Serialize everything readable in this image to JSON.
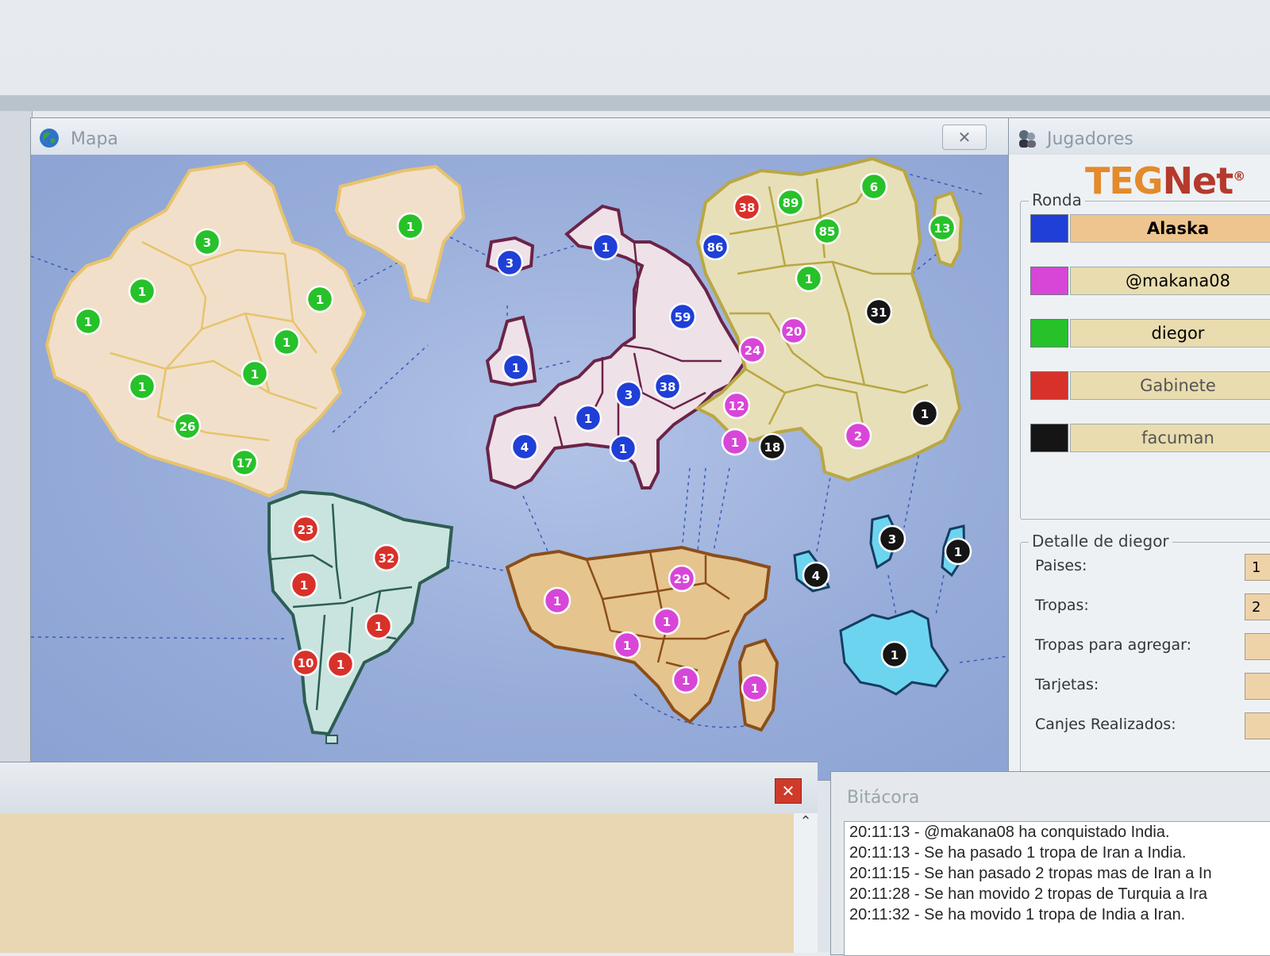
{
  "map_window": {
    "title": "Mapa",
    "close_label": "✕"
  },
  "players_window": {
    "title": "Jugadores",
    "brand_teg": "TEG",
    "brand_net": "Net",
    "brand_mark": "®"
  },
  "ronda": {
    "legend": "Ronda",
    "players": [
      {
        "name": "Alaska",
        "color": "#1f3fd6",
        "bg": "#efc58f"
      },
      {
        "name": "@makana08",
        "color": "#d846d8",
        "bg": "#e9dcae"
      },
      {
        "name": "diegor",
        "color": "#27c12a",
        "bg": "#e9dcae"
      },
      {
        "name": "Gabinete",
        "color": "#d8312a",
        "bg": "#e9dcae"
      },
      {
        "name": "facuman",
        "color": "#151515",
        "bg": "#e9dcae"
      }
    ]
  },
  "detalle": {
    "legend": "Detalle de diegor",
    "rows": [
      {
        "label": "Paises:",
        "value": "1"
      },
      {
        "label": "Tropas:",
        "value": "2"
      },
      {
        "label": "Tropas para agregar:",
        "value": ""
      },
      {
        "label": "Tarjetas:",
        "value": ""
      },
      {
        "label": "Canjes Realizados:",
        "value": ""
      }
    ]
  },
  "bottom_window": {
    "close_label": "✕",
    "scroll_up": "⌃"
  },
  "bitacora": {
    "title": "Bitácora",
    "lines": [
      "20:11:13 - @makana08 ha conquistado India.",
      "20:11:13 - Se ha pasado 1 tropa de Iran a India.",
      "20:11:15 - Se han pasado 2 tropas mas de Iran a In",
      "20:11:28 - Se han movido 2 tropas de Turquia a Ira",
      "20:11:32 - Se ha movido 1 tropa de India a Iran."
    ]
  },
  "colors": {
    "blue": "#1f3fd6",
    "pink": "#d846d8",
    "green": "#27c12a",
    "red": "#d8312a",
    "black": "#151515"
  },
  "troops": [
    {
      "v": "3",
      "c": "green"
    },
    {
      "v": "1",
      "c": "green"
    },
    {
      "v": "1",
      "c": "green"
    },
    {
      "v": "1",
      "c": "green"
    },
    {
      "v": "1",
      "c": "green"
    },
    {
      "v": "1",
      "c": "green"
    },
    {
      "v": "1",
      "c": "green"
    },
    {
      "v": "1",
      "c": "green"
    },
    {
      "v": "26",
      "c": "green"
    },
    {
      "v": "17",
      "c": "green"
    },
    {
      "v": "23",
      "c": "red"
    },
    {
      "v": "32",
      "c": "red"
    },
    {
      "v": "1",
      "c": "red"
    },
    {
      "v": "1",
      "c": "red"
    },
    {
      "v": "10",
      "c": "red"
    },
    {
      "v": "1",
      "c": "red"
    },
    {
      "v": "3",
      "c": "blue"
    },
    {
      "v": "1",
      "c": "blue"
    },
    {
      "v": "1",
      "c": "blue"
    },
    {
      "v": "59",
      "c": "blue"
    },
    {
      "v": "3",
      "c": "blue"
    },
    {
      "v": "38",
      "c": "blue"
    },
    {
      "v": "1",
      "c": "blue"
    },
    {
      "v": "4",
      "c": "blue"
    },
    {
      "v": "1",
      "c": "blue"
    },
    {
      "v": "86",
      "c": "blue"
    },
    {
      "v": "38",
      "c": "red"
    },
    {
      "v": "89",
      "c": "green"
    },
    {
      "v": "6",
      "c": "green"
    },
    {
      "v": "13",
      "c": "green"
    },
    {
      "v": "85",
      "c": "green"
    },
    {
      "v": "1",
      "c": "green"
    },
    {
      "v": "31",
      "c": "black"
    },
    {
      "v": "20",
      "c": "pink"
    },
    {
      "v": "24",
      "c": "pink"
    },
    {
      "v": "12",
      "c": "pink"
    },
    {
      "v": "1",
      "c": "pink"
    },
    {
      "v": "18",
      "c": "black"
    },
    {
      "v": "1",
      "c": "black"
    },
    {
      "v": "2",
      "c": "pink"
    },
    {
      "v": "29",
      "c": "pink"
    },
    {
      "v": "1",
      "c": "pink"
    },
    {
      "v": "1",
      "c": "pink"
    },
    {
      "v": "1",
      "c": "pink"
    },
    {
      "v": "1",
      "c": "pink"
    },
    {
      "v": "1",
      "c": "pink"
    },
    {
      "v": "3",
      "c": "black"
    },
    {
      "v": "1",
      "c": "black"
    },
    {
      "v": "4",
      "c": "black"
    },
    {
      "v": "1",
      "c": "black"
    }
  ]
}
